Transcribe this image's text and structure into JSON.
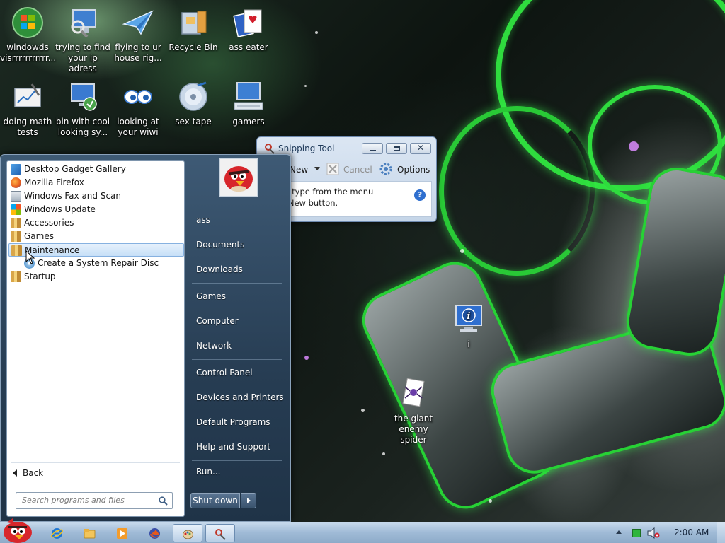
{
  "desktop": {
    "icons": [
      {
        "label": "windowds visrrrrrrrrrrr...",
        "icon": "windows-orb-icon"
      },
      {
        "label": "trying to find your ip adress",
        "icon": "network-search-icon"
      },
      {
        "label": "flying to ur house rig...",
        "icon": "paper-plane-icon"
      },
      {
        "label": "Recycle Bin",
        "icon": "recycle-bin-icon"
      },
      {
        "label": "ass eater",
        "icon": "cards-icon"
      },
      {
        "label": "doing math tests",
        "icon": "chart-icon"
      },
      {
        "label": "bin with cool looking sy...",
        "icon": "remote-desktop-icon"
      },
      {
        "label": "looking at your wiwi",
        "icon": "eyes-icon"
      },
      {
        "label": "sex tape",
        "icon": "dvd-icon"
      },
      {
        "label": "gamers",
        "icon": "keyboard-monitor-icon"
      },
      {
        "label": "i",
        "icon": "info-monitor-icon"
      },
      {
        "label": "the giant enemy spider",
        "icon": "spider-solitaire-icon"
      }
    ]
  },
  "snipping_tool": {
    "title": "Snipping Tool",
    "new_label": "New",
    "cancel_label": "Cancel",
    "options_label": "Options",
    "message_line1": "a snip type from the menu",
    "message_line2": "k the New button."
  },
  "start_menu": {
    "programs": [
      {
        "label": "Desktop Gadget Gallery",
        "icon": "gadget-icon"
      },
      {
        "label": "Mozilla Firefox",
        "icon": "firefox-icon"
      },
      {
        "label": "Windows Fax and Scan",
        "icon": "fax-icon"
      },
      {
        "label": "Windows Update",
        "icon": "windows-update-icon"
      },
      {
        "label": "Accessories",
        "icon": "folder-icon"
      },
      {
        "label": "Games",
        "icon": "folder-icon"
      },
      {
        "label": "Maintenance",
        "icon": "folder-icon"
      },
      {
        "label": "Create a System Repair Disc",
        "icon": "repair-disc-icon"
      },
      {
        "label": "Startup",
        "icon": "folder-icon"
      }
    ],
    "back_label": "Back",
    "search_placeholder": "Search programs and files",
    "right_links": {
      "user": "ass",
      "documents": "Documents",
      "downloads": "Downloads",
      "games": "Games",
      "computer": "Computer",
      "network": "Network",
      "control_panel": "Control Panel",
      "devices": "Devices and Printers",
      "default_programs": "Default Programs",
      "help": "Help and Support",
      "run": "Run..."
    },
    "shutdown_label": "Shut down"
  },
  "taskbar": {
    "clock": "2:00 AM",
    "pinned": [
      "internet-explorer-icon",
      "windows-explorer-icon",
      "media-player-icon",
      "firefox-icon",
      "paint-icon",
      "snipping-tool-icon"
    ]
  },
  "colors": {
    "accent_green": "#2fdc3e",
    "selection_blue": "#c6dff7"
  }
}
